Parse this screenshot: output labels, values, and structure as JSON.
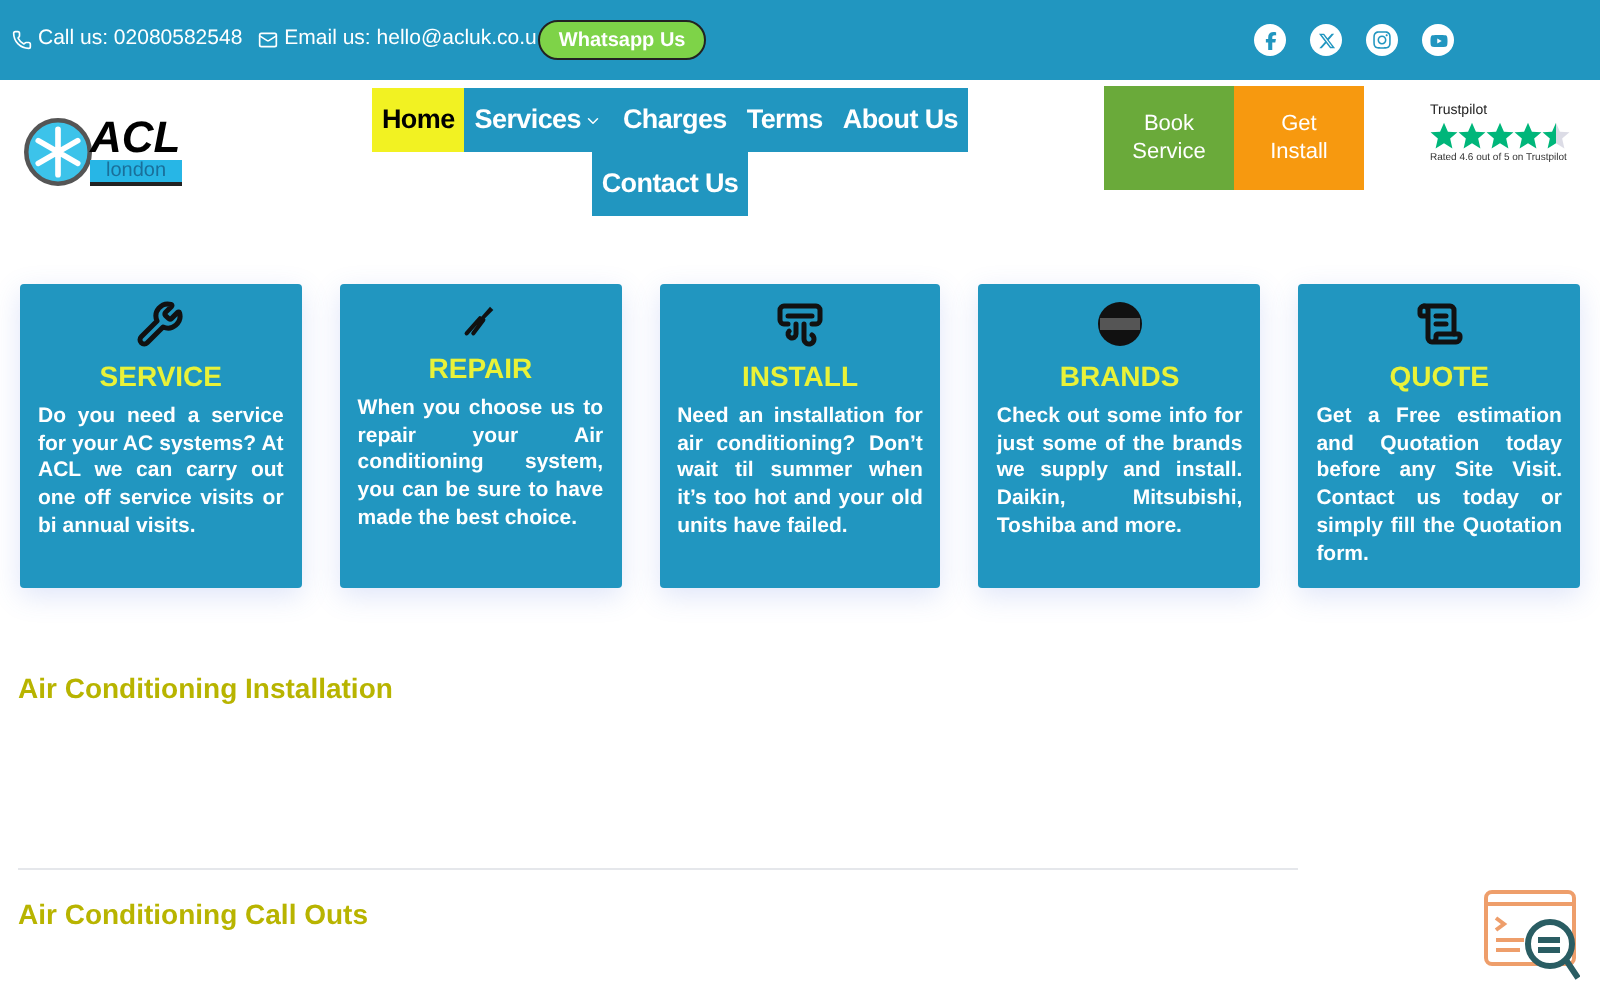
{
  "top_bar": {
    "phone": "Call us: 02080582548",
    "email": "Email us: hello@acluk.co.u",
    "whatsapp": "Whatsapp Us"
  },
  "logo": {
    "title": "ACL",
    "subtitle": "london"
  },
  "nav": [
    {
      "label": "Home",
      "selected": true,
      "dropdown": false
    },
    {
      "label": "Services",
      "selected": false,
      "dropdown": true
    },
    {
      "label": "Charges",
      "selected": false,
      "dropdown": false
    },
    {
      "label": "Terms",
      "selected": false,
      "dropdown": false
    },
    {
      "label": "About Us",
      "selected": false,
      "dropdown": false
    },
    {
      "label": "Contact Us",
      "selected": false,
      "dropdown": false
    }
  ],
  "cta": [
    {
      "label": "Book Service",
      "color": "#6aaa3a"
    },
    {
      "label": "Get Install",
      "color": "#f7990f"
    }
  ],
  "rating": {
    "brand": "Trustpilot",
    "stars": 4.5,
    "caption": "Rated 4.6 out of 5 on Trustpilot"
  },
  "cards": [
    {
      "kind": "wrench",
      "title": "SERVICE",
      "text": "Do you need a service for your AC systems? At ACL we can carry out one off service visits or bi annual visits."
    },
    {
      "kind": "pliers",
      "title": "REPAIR",
      "text": "When you choose us to repair your Air conditioning system, you can be sure to have made the best choice."
    },
    {
      "kind": "ac",
      "title": "INSTALL",
      "text": "Need an installation for air conditioning? Don’t wait til summer when it’s too hot and your old units have failed."
    },
    {
      "kind": "brand",
      "title": "BRANDS",
      "text": "Check out some info for just some of the brands we supply and install. Daikin, Mitsubishi, Toshiba and more."
    },
    {
      "kind": "quote",
      "title": "QUOTE",
      "text": "Get a Free estimation and Quotation today before any Site Visit. Contact us today or simply fill the Quotation form."
    }
  ],
  "sections": [
    "Air Conditioning Installation",
    "Air Conditioning Call Outs"
  ]
}
